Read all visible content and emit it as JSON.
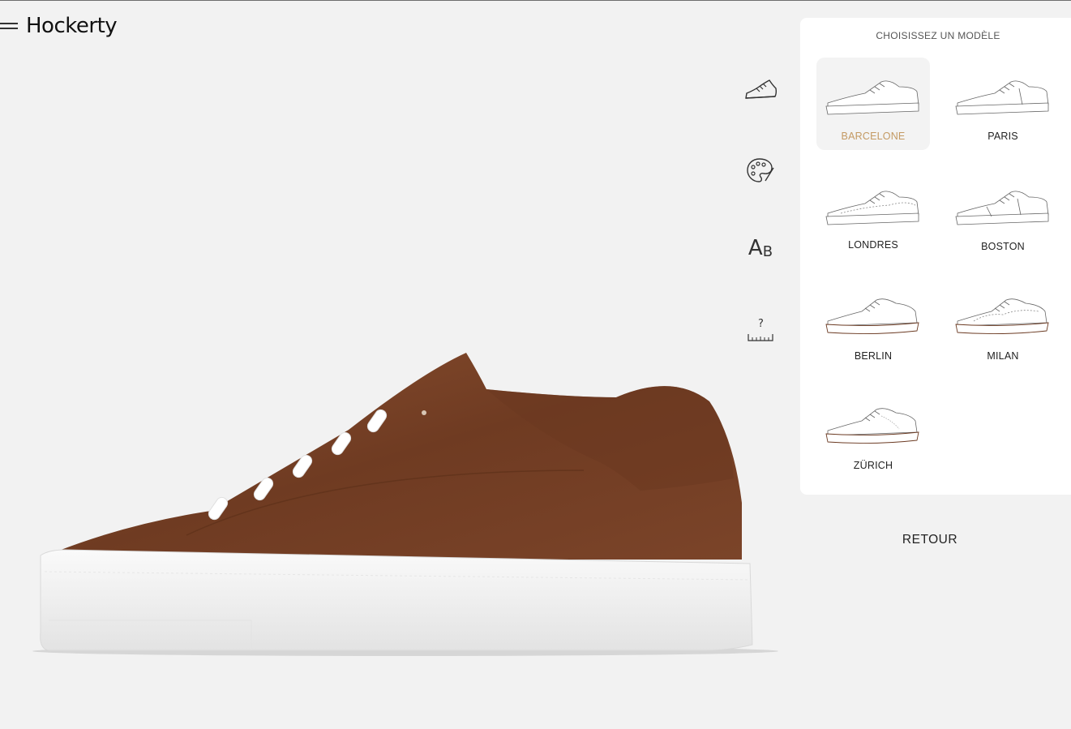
{
  "brand": {
    "logo": "Hockerty"
  },
  "menu": {
    "icon": "hamburger-menu-icon"
  },
  "tools": [
    {
      "icon": "sneaker-model-icon"
    },
    {
      "icon": "palette-icon"
    },
    {
      "icon_text_a": "A",
      "icon_text_b": "B"
    },
    {
      "icon": "size-ruler-icon",
      "glyph": "?"
    }
  ],
  "panel": {
    "title": "CHOISISSEZ UN MODÈLE",
    "models": [
      {
        "label": "BARCELONE",
        "selected": true
      },
      {
        "label": "PARIS",
        "selected": false
      },
      {
        "label": "LONDRES",
        "selected": false
      },
      {
        "label": "BOSTON",
        "selected": false
      },
      {
        "label": "BERLIN",
        "selected": false
      },
      {
        "label": "MILAN",
        "selected": false
      },
      {
        "label": "ZÜRICH",
        "selected": false
      }
    ]
  },
  "actions": {
    "back_label": "RETOUR"
  },
  "colors": {
    "background": "#f2f2f2",
    "leather": "#7a4327",
    "sole": "#f4f4f4",
    "accent": "#c49a63"
  }
}
